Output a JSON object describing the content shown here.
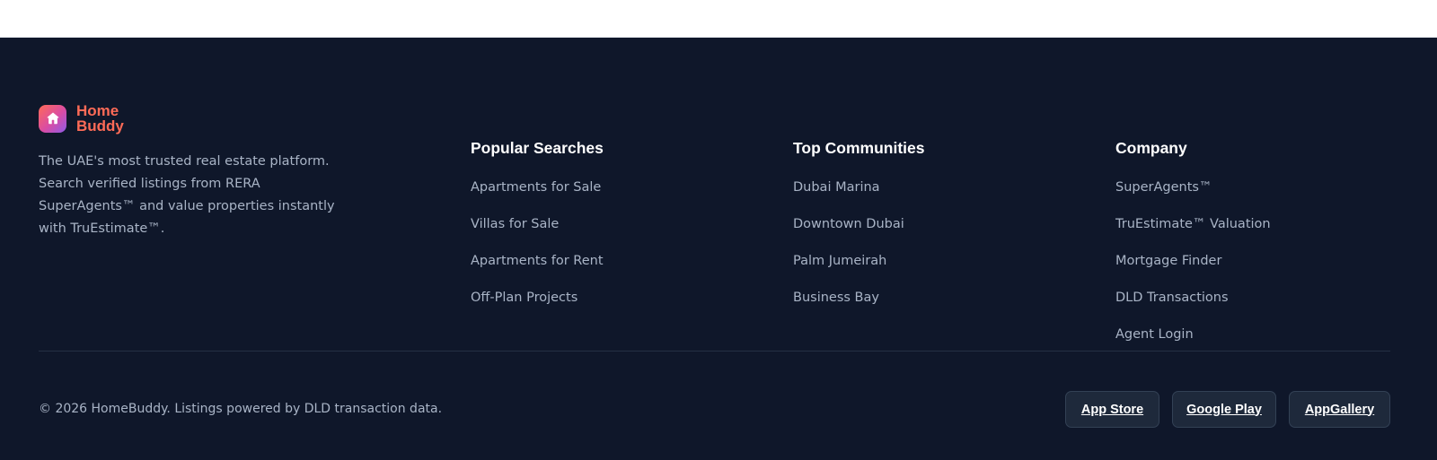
{
  "brand": {
    "name_line1": "Home",
    "name_line2": "Buddy",
    "icon": "house-icon",
    "description": "The UAE's most trusted real estate platform. Search verified listings from RERA SuperAgents™ and value properties instantly with TruEstimate™.",
    "accent_color": "#ff6b57"
  },
  "footer": {
    "background_color": "#0f172a",
    "columns": [
      {
        "title": "Popular Searches",
        "links": [
          "Apartments for Sale",
          "Villas for Sale",
          "Apartments for Rent",
          "Off-Plan Projects"
        ]
      },
      {
        "title": "Top Communities",
        "links": [
          "Dubai Marina",
          "Downtown Dubai",
          "Palm Jumeirah",
          "Business Bay"
        ]
      },
      {
        "title": "Company",
        "links": [
          "SuperAgents™",
          "TruEstimate™ Valuation",
          "Mortgage Finder",
          "DLD Transactions",
          "Agent Login"
        ]
      }
    ],
    "copyright": "© 2026 HomeBuddy. Listings powered by DLD transaction data.",
    "app_buttons": [
      "App Store",
      "Google Play",
      "AppGallery"
    ]
  }
}
